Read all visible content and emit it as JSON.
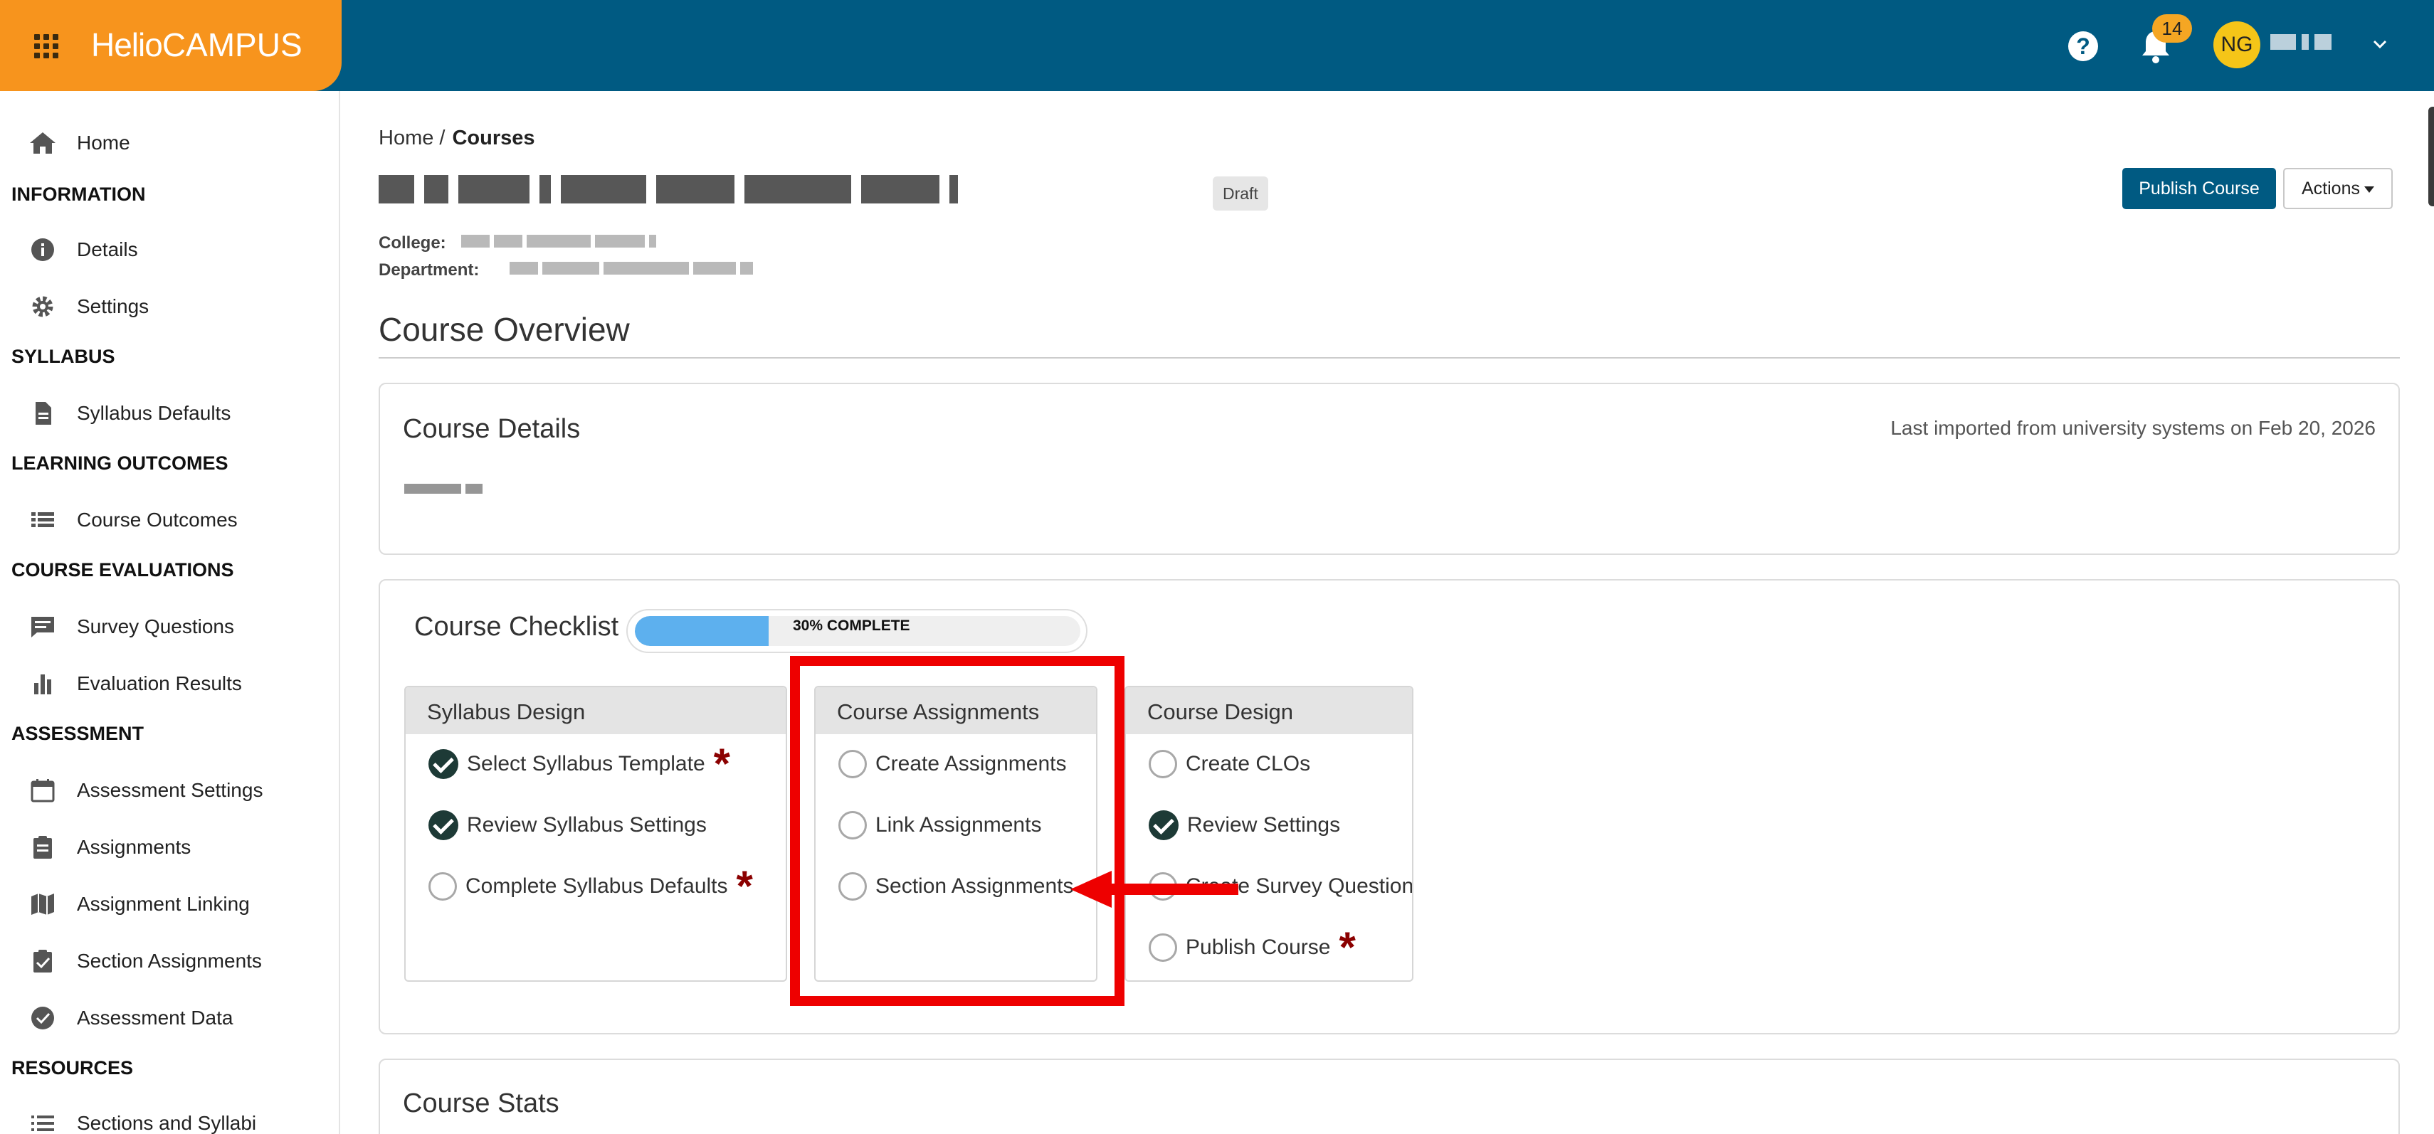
{
  "header": {
    "logo_part1": "Helio",
    "logo_part2": "CAMPUS",
    "notification_count": "14",
    "avatar_initials": "NG"
  },
  "sidebar": {
    "home": "Home",
    "sections": {
      "information": "INFORMATION",
      "syllabus": "SYLLABUS",
      "learning_outcomes": "LEARNING OUTCOMES",
      "course_evaluations": "COURSE EVALUATIONS",
      "assessment": "ASSESSMENT",
      "resources": "RESOURCES"
    },
    "items": {
      "details": "Details",
      "settings": "Settings",
      "syllabus_defaults": "Syllabus Defaults",
      "course_outcomes": "Course Outcomes",
      "survey_questions": "Survey Questions",
      "evaluation_results": "Evaluation Results",
      "assessment_settings": "Assessment Settings",
      "assignments": "Assignments",
      "assignment_linking": "Assignment Linking",
      "section_assignments": "Section Assignments",
      "assessment_data": "Assessment Data",
      "sections_and_syllabi": "Sections and Syllabi"
    }
  },
  "breadcrumb": {
    "home": "Home /",
    "current": "Courses"
  },
  "course": {
    "status_badge": "Draft",
    "college_label": "College:",
    "department_label": "Department:"
  },
  "toolbar": {
    "publish_label": "Publish Course",
    "actions_label": "Actions"
  },
  "overview": {
    "title": "Course Overview"
  },
  "details_card": {
    "title": "Course Details",
    "imported_note": "Last imported from university systems on Feb 20, 2026"
  },
  "checklist": {
    "title": "Course Checklist",
    "progress_fraction": 0.3,
    "progress_text": "30% COMPLETE",
    "required_marker": "*",
    "panels": {
      "syllabus_design": {
        "title": "Syllabus Design",
        "tasks": [
          {
            "label": "Select Syllabus Template",
            "done": true,
            "required": true
          },
          {
            "label": "Review Syllabus Settings",
            "done": true,
            "required": false
          },
          {
            "label": "Complete Syllabus Defaults",
            "done": false,
            "required": true
          }
        ]
      },
      "course_assignments": {
        "title": "Course Assignments",
        "tasks": [
          {
            "label": "Create Assignments",
            "done": false,
            "required": false
          },
          {
            "label": "Link Assignments",
            "done": false,
            "required": false
          },
          {
            "label": "Section Assignments",
            "done": false,
            "required": false
          }
        ]
      },
      "course_design": {
        "title": "Course Design",
        "tasks": [
          {
            "label": "Create CLOs",
            "done": false,
            "required": false
          },
          {
            "label": "Review Settings",
            "done": true,
            "required": false
          },
          {
            "label": "Create Survey Questions",
            "done": false,
            "required": false
          },
          {
            "label": "Publish Course",
            "done": false,
            "required": true
          }
        ]
      }
    }
  },
  "stats_card": {
    "title": "Course Stats"
  },
  "colors": {
    "topbar": "#005a82",
    "brand": "#f7941d",
    "progress": "#5db0ee",
    "highlight": "#ee0000",
    "required": "#8b0000"
  }
}
